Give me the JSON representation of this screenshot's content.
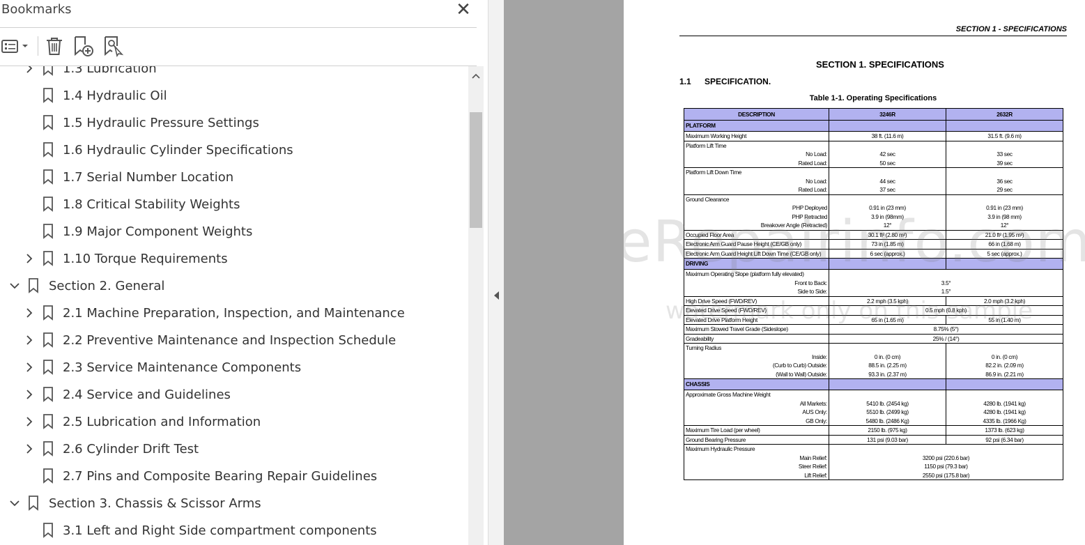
{
  "panel": {
    "title": "Bookmarks",
    "close_glyph": "✕",
    "toolbar": {
      "options_icon": "list-options-icon",
      "delete_icon": "trash-icon",
      "new_bookmark_icon": "new-bookmark-icon",
      "find_bookmark_icon": "find-bookmark-icon"
    },
    "bookmarks": [
      {
        "label": "1.3 Lubrication",
        "level": 2,
        "expander": "collapsed"
      },
      {
        "label": "1.4 Hydraulic Oil",
        "level": 2,
        "expander": "none"
      },
      {
        "label": "1.5 Hydraulic Pressure Settings",
        "level": 2,
        "expander": "none"
      },
      {
        "label": "1.6 Hydraulic Cylinder Specifications",
        "level": 2,
        "expander": "none"
      },
      {
        "label": "1.7 Serial Number Location",
        "level": 2,
        "expander": "none"
      },
      {
        "label": "1.8 Critical Stability Weights",
        "level": 2,
        "expander": "none"
      },
      {
        "label": "1.9 Major Component Weights",
        "level": 2,
        "expander": "none"
      },
      {
        "label": "1.10 Torque Requirements",
        "level": 2,
        "expander": "collapsed"
      },
      {
        "label": "Section 2. General",
        "level": 1,
        "expander": "expanded"
      },
      {
        "label": "2.1 Machine Preparation, Inspection, and Maintenance",
        "level": 2,
        "expander": "collapsed"
      },
      {
        "label": "2.2 Preventive Maintenance and Inspection Schedule",
        "level": 2,
        "expander": "collapsed"
      },
      {
        "label": "2.3 Service Maintenance Components",
        "level": 2,
        "expander": "collapsed"
      },
      {
        "label": "2.4 Service and Guidelines",
        "level": 2,
        "expander": "collapsed"
      },
      {
        "label": "2.5 Lubrication and Information",
        "level": 2,
        "expander": "collapsed"
      },
      {
        "label": "2.6 Cylinder Drift Test",
        "level": 2,
        "expander": "collapsed"
      },
      {
        "label": "2.7 Pins and Composite Bearing Repair Guidelines",
        "level": 2,
        "expander": "none"
      },
      {
        "label": "Section 3. Chassis & Scissor Arms",
        "level": 1,
        "expander": "expanded"
      },
      {
        "label": "3.1 Left and Right Side compartment components",
        "level": 2,
        "expander": "none"
      }
    ]
  },
  "document": {
    "running_head": "SECTION 1 - SPECIFICATIONS",
    "section_title": "SECTION 1.  SPECIFICATIONS",
    "subsection_number": "1.1",
    "subsection_title": "SPECIFICATION.",
    "table_caption": "Table 1-1.  Operating Specifications",
    "table": {
      "headers": [
        "DESCRIPTION",
        "3246R",
        "2632R"
      ],
      "rows": [
        {
          "type": "section",
          "label": "PLATFORM"
        },
        {
          "type": "row",
          "desc": "Maximum Working Height",
          "sub": [],
          "a": [
            "38 ft. (11.6 m)"
          ],
          "b": [
            "31.5 ft. (9.6 m)"
          ]
        },
        {
          "type": "row",
          "desc": "Platform Lift Time",
          "sub": [
            "No Load:",
            "Rated Load:"
          ],
          "a": [
            "42 sec",
            "50 sec"
          ],
          "b": [
            "33 sec",
            "39 sec"
          ]
        },
        {
          "type": "row",
          "desc": "Platform Lift Down Time",
          "sub": [
            "No Load:",
            "Rated Load:"
          ],
          "a": [
            "44 sec",
            "37 sec"
          ],
          "b": [
            "36 sec",
            "29 sec"
          ]
        },
        {
          "type": "row",
          "desc": "Ground Clearance",
          "sub": [
            "PHP Deployed",
            "PHP Retracted",
            "Breakover Angle (Retracted)"
          ],
          "a": [
            "0.91 in (23 mm)",
            "3.9 in (98mm)",
            "12°"
          ],
          "b": [
            "0.91 in (23 mm)",
            "3.9 in (98 mm)",
            "12°"
          ]
        },
        {
          "type": "row",
          "desc": "Occupied Floor Area",
          "sub": [],
          "a": [
            "30.1 ft² (2.80 m²)"
          ],
          "b": [
            "21.0 ft² (1.95 m²)"
          ]
        },
        {
          "type": "row",
          "desc": "Electronic Arm Guard Pause Height (CE/GB only)",
          "sub": [],
          "a": [
            "73 in (1.85 m)"
          ],
          "b": [
            "66 in (1.68 m)"
          ]
        },
        {
          "type": "row",
          "desc": "Electronic Arm Guard Height Lift Down Time (CE/GB only)",
          "sub": [],
          "a": [
            "6 sec (approx.)"
          ],
          "b": [
            "5 sec (approx.)"
          ]
        },
        {
          "type": "section",
          "label": "DRIVING"
        },
        {
          "type": "merged",
          "desc": "Maximum Operating Slope (platform fully elevated)",
          "sub": [
            "Front to Back:",
            "Side to Side:"
          ],
          "v": [
            "3.5°",
            "1.5°"
          ]
        },
        {
          "type": "row",
          "desc": "High Drive Speed (FWD/REV)",
          "sub": [],
          "a": [
            "2.2 mph (3.5 kph)"
          ],
          "b": [
            "2.0 mph (3.2 kph)"
          ]
        },
        {
          "type": "merged",
          "desc": "Elevated Drive Speed (FWD/REV)",
          "sub": [],
          "v": [
            "0.5 mph (0.8 kph)"
          ]
        },
        {
          "type": "row",
          "desc": "Elevated Drive Platform Height",
          "sub": [],
          "a": [
            "65 in (1.65 m)"
          ],
          "b": [
            "55 in (1.40 m)"
          ]
        },
        {
          "type": "merged",
          "desc": "Maximum Stowed Travel Grade (Sideslope)",
          "sub": [],
          "v": [
            "8.75% (5°)"
          ]
        },
        {
          "type": "merged",
          "desc": "Gradeability",
          "sub": [],
          "v": [
            "25% / (14°)"
          ]
        },
        {
          "type": "row",
          "desc": "Turning Radius",
          "sub": [
            "Inside:",
            "(Curb to Curb) Outside:",
            "(Wall to Wall) Outside:"
          ],
          "a": [
            "0 in. (0 cm)",
            "88.5 in. (2.25 m)",
            "93.3 in. (2.37 m)"
          ],
          "b": [
            "0 in. (0 cm)",
            "82.2 in. (2.09 m)",
            "86.9 in. (2.21 m)"
          ]
        },
        {
          "type": "section",
          "label": "CHASSIS"
        },
        {
          "type": "row",
          "desc": "Approximate Gross Machine Weight",
          "sub": [
            "All Markets:",
            "AUS Only:",
            "GB Only:"
          ],
          "a": [
            "5410 lb. (2454 kg)",
            "5510 lb. (2499 kg)",
            "5480 lb. (2486 Kg)"
          ],
          "b": [
            "4280 lb. (1941 kg)",
            "4280 lb. (1941 kg)",
            "4335 lb. (1966 Kg)"
          ]
        },
        {
          "type": "row",
          "desc": "Maximum Tire Load (per wheel)",
          "sub": [],
          "a": [
            "2150 lb. (975 kg)"
          ],
          "b": [
            "1373 lb. (623 kg)"
          ]
        },
        {
          "type": "row",
          "desc": "Ground Bearing Pressure",
          "sub": [],
          "a": [
            "131 psi (9.03 bar)"
          ],
          "b": [
            "92 psi (6.34 bar)"
          ]
        },
        {
          "type": "merged",
          "desc": "Maximum Hydraulic Pressure",
          "sub": [
            "Main Relief:",
            "Steer Relief:",
            "Lift Relief:"
          ],
          "v": [
            "3200 psi (220.6 bar)",
            "1150 psi (79.3 bar)",
            "2550 psi (175.8 bar)"
          ]
        }
      ]
    },
    "watermark_main": "eRepairinfo.com",
    "watermark_sub": "watermark only on this sample"
  },
  "colors": {
    "table_header": "#b2b2f0",
    "gray_area": "#a4a4a4",
    "scroll_thumb": "#c2c2c2"
  }
}
